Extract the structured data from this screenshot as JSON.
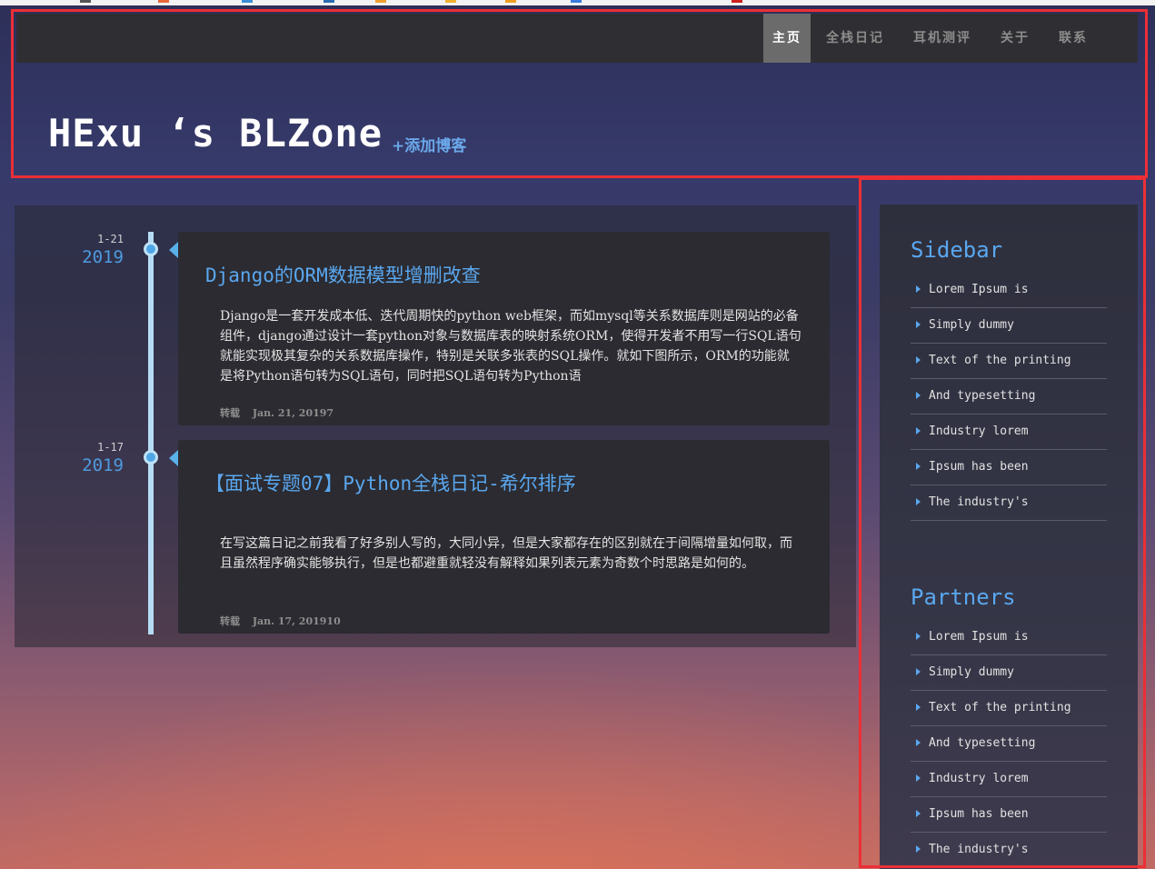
{
  "colors": {
    "accent": "#5aa7ef",
    "annotation": "#ec2f36",
    "nav_bg": "#2f2f33",
    "card_bg": "#2b2b31"
  },
  "nav": {
    "items": [
      {
        "label": "主页",
        "active": true
      },
      {
        "label": "全栈日记",
        "active": false
      },
      {
        "label": "耳机测评",
        "active": false
      },
      {
        "label": "关于",
        "active": false
      },
      {
        "label": "联系",
        "active": false
      }
    ]
  },
  "header": {
    "title": "HExu ‘s BLZone",
    "add_blog": "+添加博客"
  },
  "posts": [
    {
      "month_day": "1-21",
      "year": "2019",
      "title": "Django的ORM数据模型增删改查",
      "excerpt": "Django是一套开发成本低、迭代周期快的python web框架，而如mysql等关系数据库则是网站的必备组件，django通过设计一套python对象与数据库表的映射系统ORM，使得开发者不用写一行SQL语句就能实现极其复杂的关系数据库操作，特别是关联多张表的SQL操作。就如下图所示，ORM的功能就是将Python语句转为SQL语句，同时把SQL语句转为Python语",
      "tag": "转载",
      "date": "Jan. 21, 20197"
    },
    {
      "month_day": "1-17",
      "year": "2019",
      "title": "【面试专题07】Python全栈日记-希尔排序",
      "excerpt": "在写这篇日记之前我看了好多别人写的，大同小异，但是大家都存在的区别就在于间隔增量如何取，而且虽然程序确实能够执行，但是也都避重就轻没有解释如果列表元素为奇数个时思路是如何的。",
      "tag": "转载",
      "date": "Jan. 17, 201910"
    }
  ],
  "sidebar": {
    "heading": "Sidebar",
    "items": [
      "Lorem Ipsum is",
      "Simply dummy",
      "Text of the printing",
      "And typesetting",
      "Industry lorem",
      "Ipsum has been",
      "The industry's"
    ]
  },
  "partners": {
    "heading": "Partners",
    "items": [
      "Lorem Ipsum is",
      "Simply dummy",
      "Text of the printing",
      "And typesetting",
      "Industry lorem",
      "Ipsum has been",
      "The industry's"
    ]
  }
}
